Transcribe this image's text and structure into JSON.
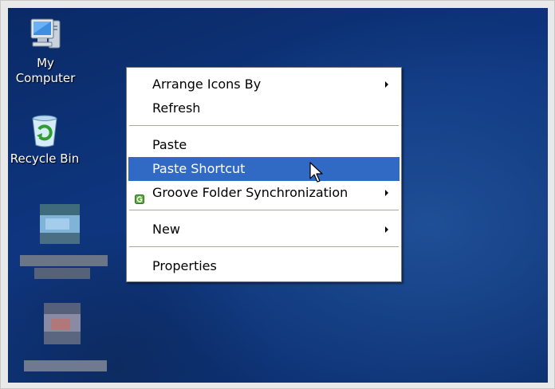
{
  "desktop": {
    "icons": [
      {
        "label_line1": "My",
        "label_line2": "Computer",
        "icon": "my-computer-icon"
      },
      {
        "label_line1": "Recycle Bin",
        "icon": "recycle-bin-icon"
      },
      {
        "label_line1": "",
        "icon": "pixelated-icon"
      },
      {
        "label_line1": "",
        "icon": "pixelated-icon"
      }
    ],
    "background_color": "#0e3680"
  },
  "context_menu": {
    "items": [
      {
        "label": "Arrange Icons By",
        "submenu": true
      },
      {
        "label": "Refresh",
        "submenu": false
      },
      {
        "label": "Paste",
        "submenu": false
      },
      {
        "label": "Paste Shortcut",
        "submenu": false,
        "highlighted": true
      },
      {
        "label": "Groove Folder Synchronization",
        "submenu": true,
        "icon": "groove-icon"
      },
      {
        "label": "New",
        "submenu": true
      },
      {
        "label": "Properties",
        "submenu": false
      }
    ],
    "highlight_color": "#316ac5"
  }
}
